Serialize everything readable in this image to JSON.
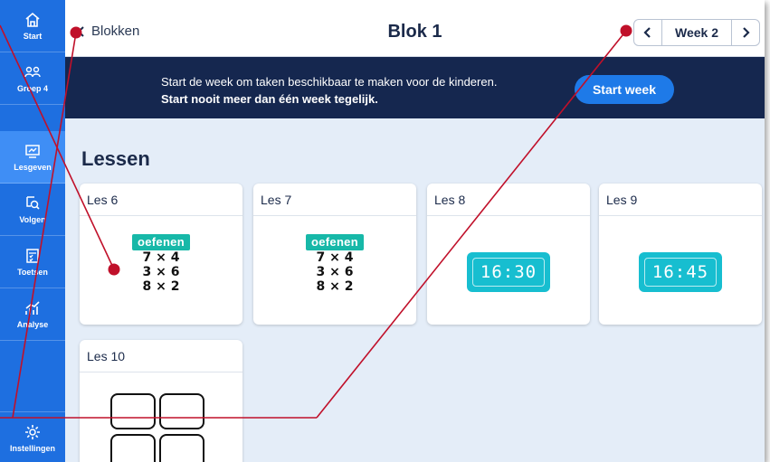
{
  "sidebar": {
    "items": [
      {
        "label": "Start",
        "icon": "home-icon"
      },
      {
        "label": "Groep 4",
        "icon": "group-icon"
      },
      {
        "label": "Lesgeven",
        "icon": "teach-icon"
      },
      {
        "label": "Volgen",
        "icon": "follow-icon"
      },
      {
        "label": "Toetsen",
        "icon": "test-icon"
      },
      {
        "label": "Analyse",
        "icon": "chart-icon"
      }
    ],
    "settings_label": "Instellingen"
  },
  "header": {
    "back_label": "Blokken",
    "title": "Blok 1",
    "week_label": "Week 2"
  },
  "banner": {
    "line1": "Start de week om taken beschikbaar te maken voor de kinderen.",
    "line2": "Start nooit meer dan één week tegelijk.",
    "button": "Start week"
  },
  "lessons": {
    "title": "Lessen",
    "cards": [
      {
        "name": "Les 6",
        "badge": "oefenen",
        "sums": [
          "7 × 4",
          "3 × 6",
          "8 × 2"
        ]
      },
      {
        "name": "Les 7",
        "badge": "oefenen",
        "sums": [
          "7 × 4",
          "3 × 6",
          "8 × 2"
        ]
      },
      {
        "name": "Les 8",
        "clock": "16:30"
      },
      {
        "name": "Les 9",
        "clock": "16:45"
      },
      {
        "name": "Les 10"
      }
    ]
  },
  "colors": {
    "sidebar": "#1e6fe0",
    "banner": "#15274f",
    "accent": "#1e7ae8",
    "badge": "#17b8a8",
    "clock": "#17bed0",
    "annotation": "#c0102a"
  }
}
